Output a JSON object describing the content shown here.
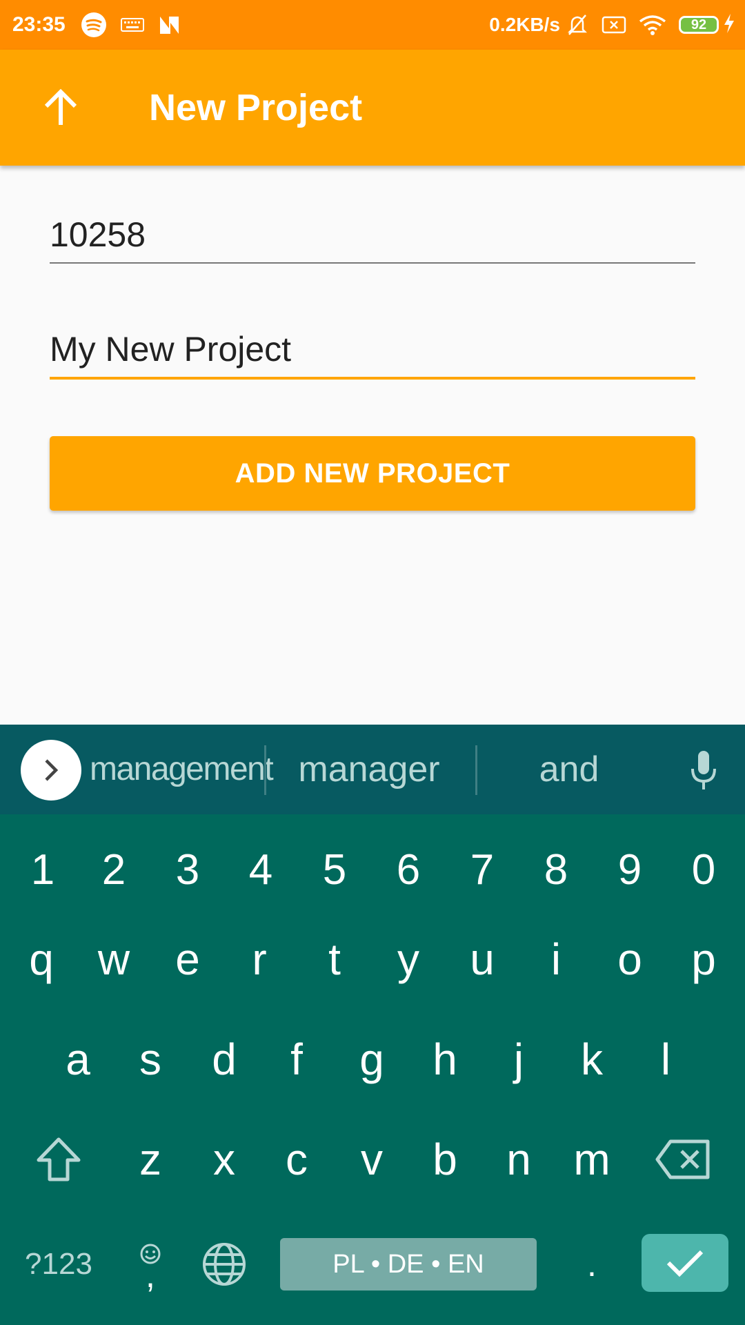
{
  "status_bar": {
    "time": "23:35",
    "net_speed": "0.2KB/s",
    "battery": "92",
    "left_icons": [
      "spotify-icon",
      "keyboard-icon",
      "n-app-icon"
    ],
    "right_icons": [
      "bell-muted-icon",
      "sim-off-icon",
      "wifi-icon",
      "battery-icon",
      "charging-icon"
    ]
  },
  "app_bar": {
    "title": "New Project",
    "back_icon": "arrow-up-icon"
  },
  "form": {
    "project_number": "10258",
    "project_name": "My New Project",
    "add_button_label": "ADD NEW PROJECT"
  },
  "keyboard": {
    "suggestions": [
      "management",
      "manager",
      "and"
    ],
    "number_row": [
      "1",
      "2",
      "3",
      "4",
      "5",
      "6",
      "7",
      "8",
      "9",
      "0"
    ],
    "row1": [
      "q",
      "w",
      "e",
      "r",
      "t",
      "y",
      "u",
      "i",
      "o",
      "p"
    ],
    "row2": [
      "a",
      "s",
      "d",
      "f",
      "g",
      "h",
      "j",
      "k",
      "l"
    ],
    "row3": [
      "z",
      "x",
      "c",
      "v",
      "b",
      "n",
      "m"
    ],
    "symbols_label": "?123",
    "comma_label": ",",
    "period_label": ".",
    "space_label": "PL • DE • EN"
  },
  "colors": {
    "status_bar": "#ff8c00",
    "app_bar": "#ffa500",
    "accent": "#ffa500",
    "keyboard_bg": "#00695c",
    "suggestion_bar": "#075a61",
    "enter_key": "#4db6ac"
  }
}
